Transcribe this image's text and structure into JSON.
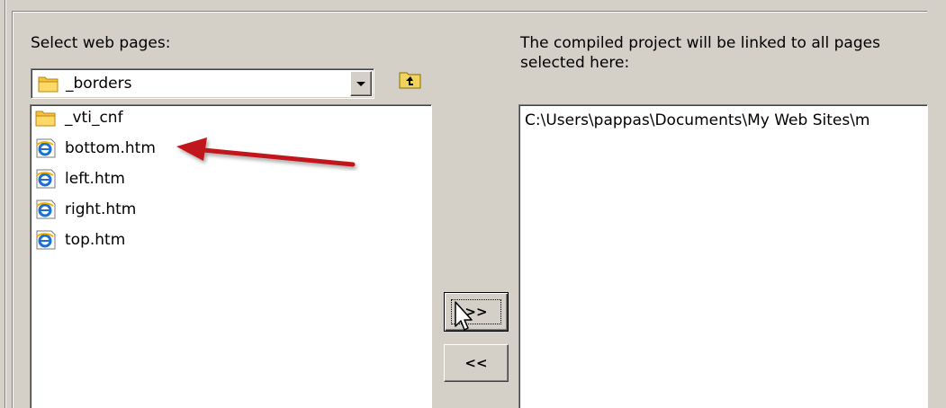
{
  "source_panel": {
    "label": "Select web pages:",
    "current_folder": "_borders",
    "files": [
      {
        "name": "_vti_cnf",
        "icon": "folder-icon"
      },
      {
        "name": "bottom.htm",
        "icon": "ie-document-icon"
      },
      {
        "name": "left.htm",
        "icon": "ie-document-icon"
      },
      {
        "name": "right.htm",
        "icon": "ie-document-icon"
      },
      {
        "name": "top.htm",
        "icon": "ie-document-icon"
      }
    ]
  },
  "target_panel": {
    "label_line1": "The compiled project will be linked to all pages",
    "label_line2": "selected here:",
    "selected": [
      "C:\\Users\\pappas\\Documents\\My Web Sites\\m"
    ]
  },
  "buttons": {
    "add_label": ">>",
    "remove_label": "<<"
  },
  "colors": {
    "dialog_bg": "#d4d0c8",
    "annotation_arrow": "#c0161b",
    "folder_yellow": "#f2c244",
    "ie_blue": "#1e6fd1"
  }
}
